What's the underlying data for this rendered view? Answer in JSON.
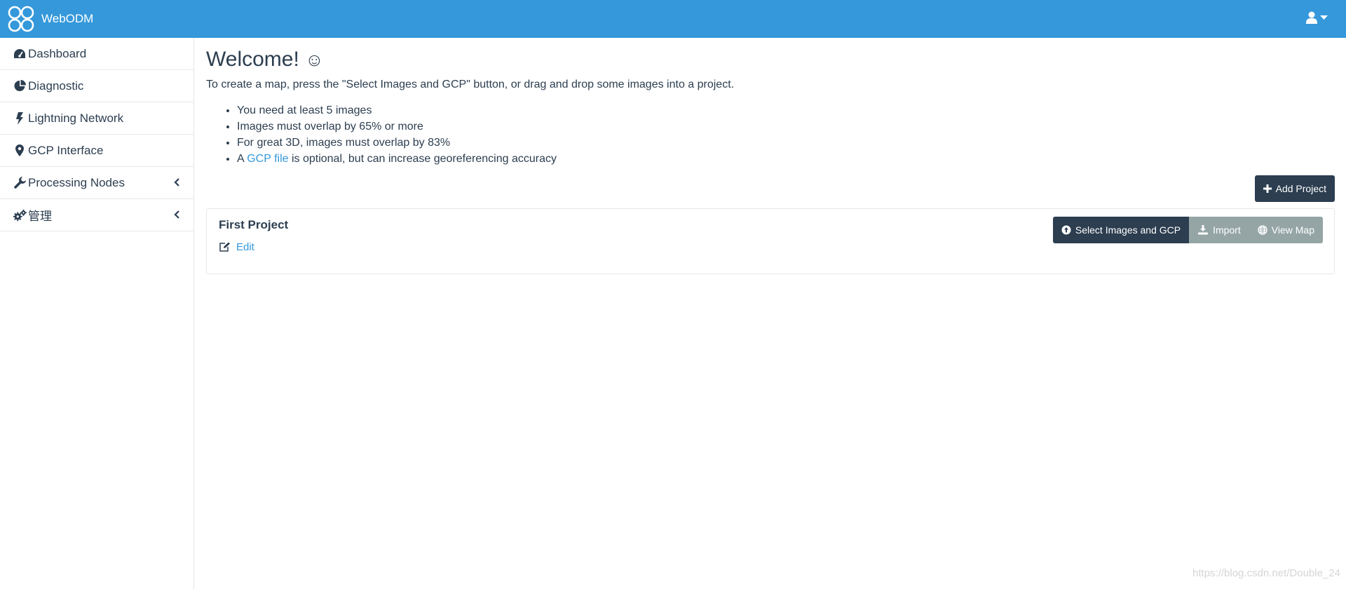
{
  "navbar": {
    "brand": "WebODM",
    "logo_icon": "webodm-logo-icon",
    "user_icon": "user-icon",
    "accent_color": "#3498db"
  },
  "sidebar": {
    "items": [
      {
        "label": "Dashboard",
        "icon": "dashboard-icon"
      },
      {
        "label": "Diagnostic",
        "icon": "pie-chart-icon"
      },
      {
        "label": "Lightning Network",
        "icon": "bolt-icon"
      },
      {
        "label": "GCP Interface",
        "icon": "map-marker-icon"
      },
      {
        "label": "Processing Nodes",
        "icon": "wrench-icon",
        "expandable": true
      },
      {
        "label": "管理",
        "icon": "cogs-icon",
        "expandable": true
      }
    ]
  },
  "main": {
    "title": "Welcome!",
    "title_emoji": "☺",
    "intro": "To create a map, press the \"Select Images and GCP\" button, or drag and drop some images into a project.",
    "tips": [
      "You need at least 5 images",
      "Images must overlap by 65% or more",
      "For great 3D, images must overlap by 83%"
    ],
    "gcp_tip": {
      "prefix": "A ",
      "link": "GCP file",
      "suffix": " is optional, but can increase georeferencing accuracy"
    },
    "add_project_label": "Add Project"
  },
  "project": {
    "name": "First Project",
    "edit_label": "Edit",
    "select_images_label": "Select Images and GCP",
    "import_label": "Import",
    "view_map_label": "View Map"
  },
  "watermark": "https://blog.csdn.net/Double_24"
}
